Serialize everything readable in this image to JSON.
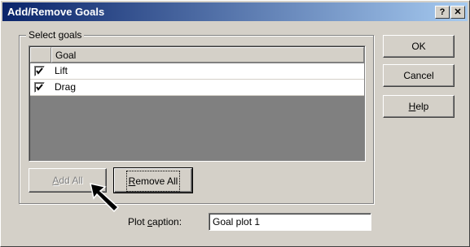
{
  "window": {
    "title": "Add/Remove Goals",
    "help_button": "?",
    "close_button": "✕"
  },
  "goals_group": {
    "legend": "Select goals",
    "column_header": "Goal",
    "items": [
      {
        "label": "Lift",
        "checked": true
      },
      {
        "label": "Drag",
        "checked": true
      }
    ]
  },
  "buttons": {
    "add_all": {
      "pre": "",
      "mn": "A",
      "post": "dd All"
    },
    "remove_all": {
      "pre": "",
      "mn": "R",
      "post": "emove All"
    },
    "ok": "OK",
    "cancel": "Cancel",
    "help": {
      "pre": "",
      "mn": "H",
      "post": "elp"
    }
  },
  "caption": {
    "label_pre": "Plot ",
    "label_mn": "c",
    "label_post": "aption:",
    "value": "Goal plot 1"
  }
}
